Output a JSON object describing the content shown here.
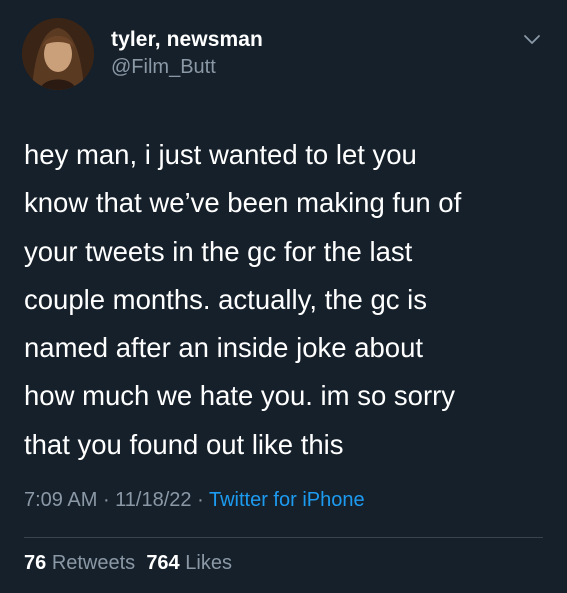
{
  "author": {
    "display_name": "tyler, newsman",
    "handle": "@Film_Butt"
  },
  "tweet": {
    "text": "hey man, i just wanted to let you\nknow that we’ve been making fun of\nyour tweets in the gc for the last\ncouple months. actually, the gc is\nnamed after an inside joke about\nhow much we hate you. im so sorry\nthat you found out like this",
    "time": "7:09 AM",
    "date": "11/18/22",
    "separator": " · ",
    "source": "Twitter for iPhone"
  },
  "stats": {
    "retweets_count": "76",
    "retweets_label": "Retweets",
    "likes_count": "764",
    "likes_label": "Likes"
  },
  "icons": {
    "menu": "chevron-down-icon",
    "avatar": "user-avatar"
  },
  "colors": {
    "background": "#15202b",
    "secondary_text": "#8b98a5",
    "accent": "#1d9bf0",
    "divider": "#38444d"
  }
}
